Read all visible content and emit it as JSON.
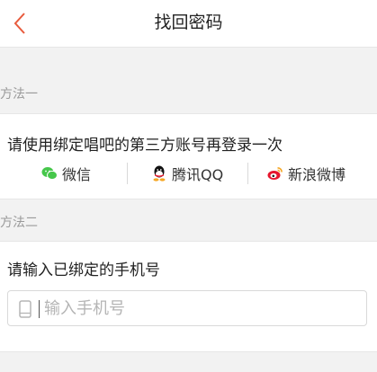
{
  "header": {
    "title": "找回密码",
    "back_icon": "chevron-left-icon"
  },
  "colors": {
    "accent": "#e85a3c",
    "wechat": "#46c74b",
    "weibo": "#e6162d"
  },
  "method1": {
    "label": "方法一",
    "instruction": "请使用绑定唱吧的第三方账号再登录一次",
    "options": [
      {
        "label": "微信",
        "icon": "wechat-icon"
      },
      {
        "label": "腾讯QQ",
        "icon": "qq-icon"
      },
      {
        "label": "新浪微博",
        "icon": "weibo-icon"
      }
    ]
  },
  "method2": {
    "label": "方法二",
    "instruction": "请输入已绑定的手机号",
    "phone_placeholder": "输入手机号",
    "phone_value": "",
    "input_icon": "phone-icon"
  }
}
